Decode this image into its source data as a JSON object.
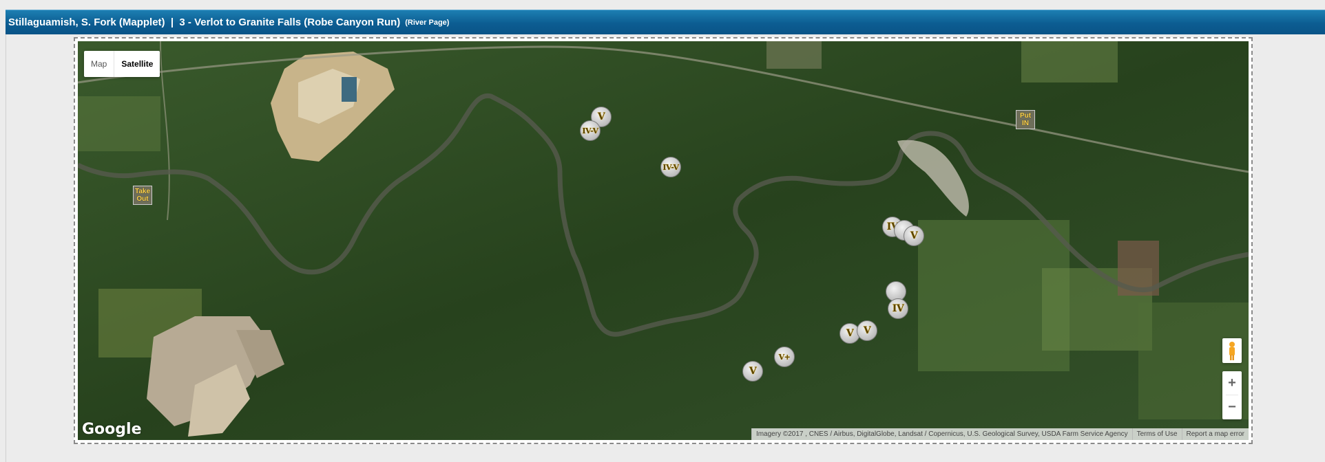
{
  "header": {
    "title": "Stillaguamish, S. Fork (Mapplet)  |  3 - Verlot to Granite Falls (Robe Canyon Run)",
    "river_page_link": "(River Page)"
  },
  "map": {
    "type_controls": {
      "map_label": "Map",
      "satellite_label": "Satellite",
      "active": "Satellite"
    },
    "zoom_in_label": "+",
    "zoom_out_label": "−",
    "google_logo": "Google",
    "attribution": {
      "imagery": "Imagery ©2017 , CNES / Airbus, DigitalGlobe, Landsat / Copernicus, U.S. Geological Survey, USDA Farm Service Agency",
      "terms": "Terms of Use",
      "report": "Report a map error"
    },
    "colors": {
      "rapid_text": "#ffd34a",
      "marker_fill": "#d9d9d9",
      "forest": "#2d4a22"
    },
    "access_points": [
      {
        "label_line1": "Take",
        "label_line2": "Out"
      },
      {
        "label_line1": "Put",
        "label_line2": "IN"
      }
    ],
    "rapids": [
      {
        "grade": "V"
      },
      {
        "grade": "IV-V"
      },
      {
        "grade": "IV-V"
      },
      {
        "grade": "IV"
      },
      {
        "grade": ""
      },
      {
        "grade": "V"
      },
      {
        "grade": ""
      },
      {
        "grade": "IV"
      },
      {
        "grade": "V"
      },
      {
        "grade": "V"
      },
      {
        "grade": "V+"
      },
      {
        "grade": "V"
      }
    ]
  }
}
